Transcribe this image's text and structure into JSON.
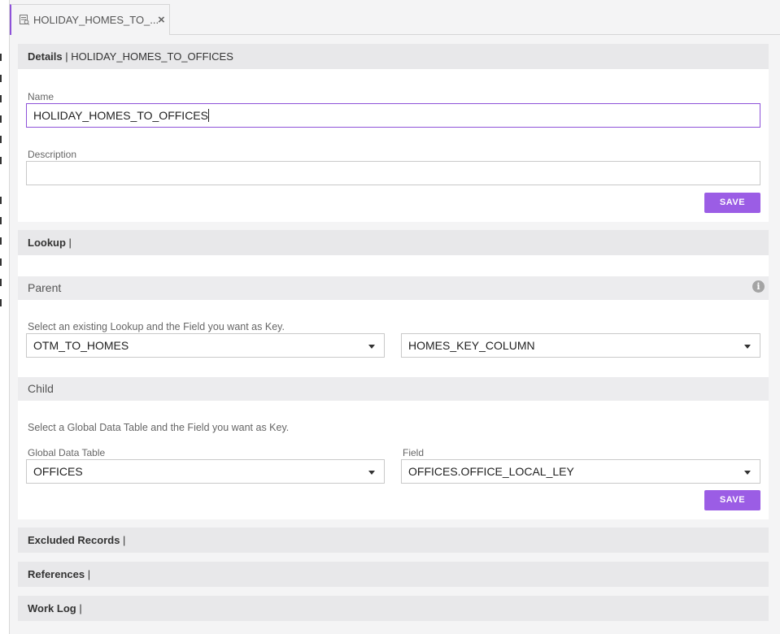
{
  "tab": {
    "title": "HOLIDAY_HOMES_TO_...",
    "close": "×"
  },
  "details": {
    "header_label": "Details",
    "header_sep": " | ",
    "header_name": "HOLIDAY_HOMES_TO_OFFICES",
    "name_label": "Name",
    "name_value": "HOLIDAY_HOMES_TO_OFFICES",
    "description_label": "Description",
    "description_value": "",
    "save_label": "SAVE"
  },
  "lookup": {
    "header_label": "Lookup",
    "header_sep": " |",
    "parent": {
      "title": "Parent",
      "instruction": "Select an existing Lookup and the Field you want as Key.",
      "lookup_value": "OTM_TO_HOMES",
      "field_value": "HOMES_KEY_COLUMN"
    },
    "child": {
      "title": "Child",
      "instruction": "Select a Global Data Table and the Field you want as Key.",
      "table_label": "Global Data Table",
      "table_value": "OFFICES",
      "field_label": "Field",
      "field_value": "OFFICES.OFFICE_LOCAL_LEY"
    },
    "save_label": "SAVE"
  },
  "excluded": {
    "header_label": "Excluded Records",
    "header_sep": " |"
  },
  "references": {
    "header_label": "References",
    "header_sep": " |"
  },
  "worklog": {
    "header_label": "Work Log",
    "header_sep": " |"
  },
  "colors": {
    "accent": "#9b5de5",
    "focus": "#8e52d9",
    "header_bg": "#e8e8ea"
  }
}
